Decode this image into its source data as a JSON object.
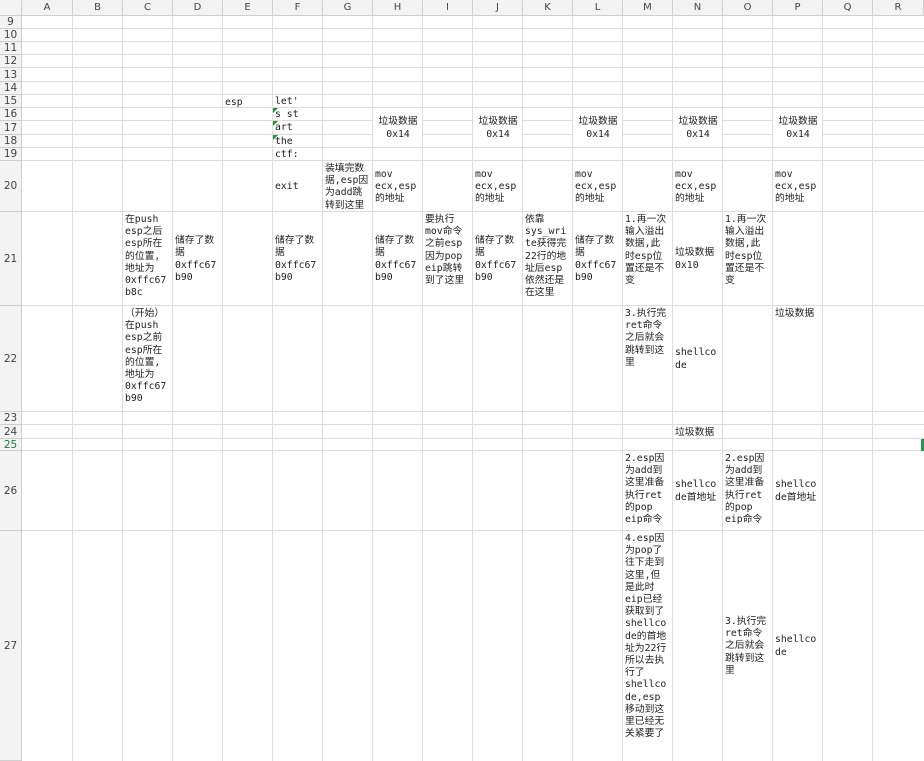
{
  "columns": [
    "A",
    "B",
    "C",
    "D",
    "E",
    "F",
    "G",
    "H",
    "I",
    "J",
    "K",
    "L",
    "M",
    "N",
    "O",
    "P",
    "Q",
    "R"
  ],
  "rows": [
    "9",
    "10",
    "11",
    "12",
    "13",
    "14",
    "15",
    "16",
    "17",
    "18",
    "19",
    "20",
    "21",
    "22",
    "23",
    "24",
    "25",
    "26",
    "27"
  ],
  "active_row": "25",
  "cells": {
    "E15": "esp",
    "F15": "let'",
    "F16": "s st",
    "F17": "art",
    "F18": "the",
    "F19": "ctf:",
    "H_trash": "垃圾数据\n0x14",
    "J_trash": "垃圾数据\n0x14",
    "L_trash": "垃圾数据\n0x14",
    "N_trash": "垃圾数据\n0x14",
    "P_trash": "垃圾数据\n0x14",
    "F20": "exit",
    "G20": "装填完数据,esp因为add跳转到这里",
    "H20": "mov\necx,esp\n的地址",
    "J20": "mov\necx,esp\n的地址",
    "L20": "mov\necx,esp\n的地址",
    "N20": "mov\necx,esp\n的地址",
    "P20": "mov\necx,esp\n的地址",
    "C21": "在push\nesp之后\nesp所在\n的位置,\n地址为\n0xffc67\nb8c",
    "D21": "储存了数\n据\n0xffc67\nb90",
    "F21": "储存了数\n据\n0xffc67\nb90",
    "H21": "储存了数\n据\n0xffc67\nb90",
    "I21": "要执行\nmov命令\n之前esp\n因为pop\neip跳转\n到了这里",
    "J21": "储存了数\n据\n0xffc67\nb90",
    "K21": "依靠\nsys_wri\nte获得完\n22行的地\n址后esp\n依然还是\n在这里",
    "L21": "储存了数\n据\n0xffc67\nb90",
    "M21": "1.再一次\n输入溢出\n数据,此\n时esp位\n置还是不\n变",
    "N21": "垃圾数据\n0x10",
    "O21": "1.再一次\n输入溢出\n数据,此\n时esp位\n置还是不\n变",
    "C22": "（开始）\n在push\nesp之前\nesp所在\n的位置,\n地址为\n0xffc67\nb90",
    "M22": "3.执行完\nret命令\n之后就会\n跳转到这\n里",
    "N22": "shellco\nde",
    "P22": "垃圾数据",
    "N24": "垃圾数据",
    "M26": "2.esp因\n为add到\n这里准备\n执行ret\n的pop\neip命令",
    "N26": "shellco\nde首地址",
    "O26": "2.esp因\n为add到\n这里准备\n执行ret\n的pop\neip命令",
    "P26": "shellco\nde首地址",
    "M27": "4.esp因\n为pop了\n往下走到\n这里,但\n是此时\neip已经\n获取到了\nshellco\nde的首地\n址为22行\n所以去执\n行了\nshellco\nde,esp\n移动到这\n里已经无\n关紧要了",
    "O27": "3.执行完\nret命令\n之后就会\n跳转到这\n里",
    "P27": "shellco\nde"
  }
}
